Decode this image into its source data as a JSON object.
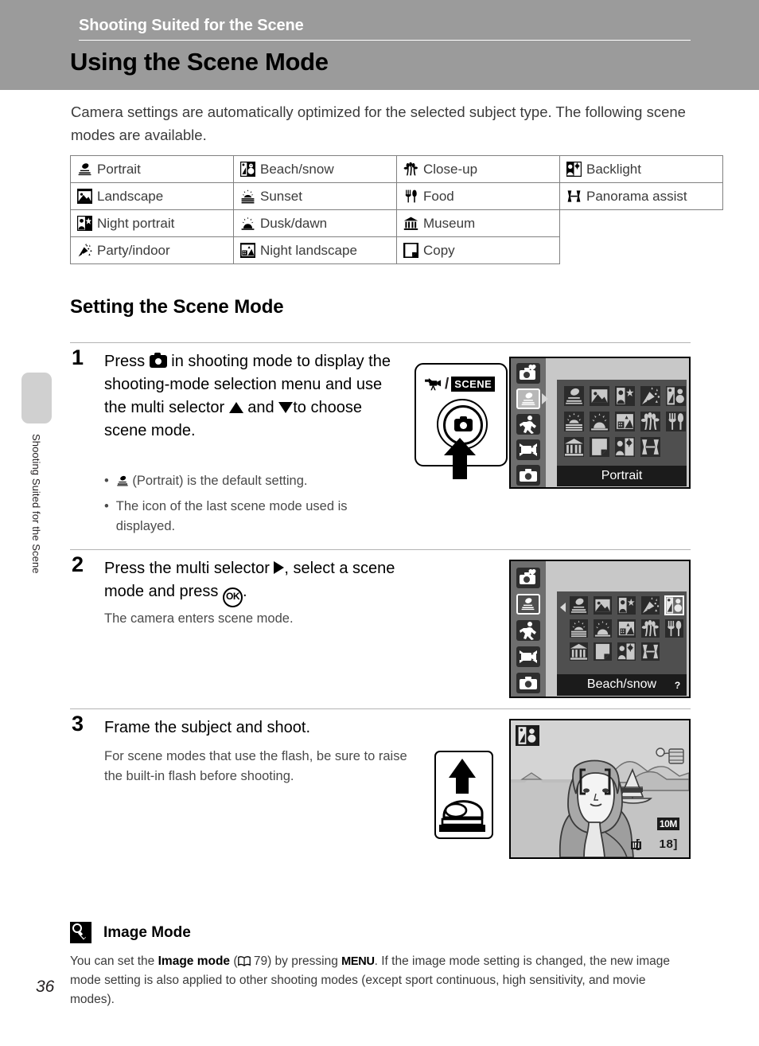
{
  "header": {
    "section_title": "Shooting Suited for the Scene",
    "chapter_title": "Using the Scene Mode"
  },
  "side": {
    "vertical_text": "Shooting Suited for the Scene",
    "page_number": "36"
  },
  "intro": "Camera settings are automatically optimized for the selected subject type. The following scene modes are available.",
  "scene_table": {
    "rows": [
      [
        {
          "icon": "portrait-icon",
          "label": "Portrait"
        },
        {
          "icon": "beach-snow-icon",
          "label": "Beach/snow"
        },
        {
          "icon": "close-up-icon",
          "label": "Close-up"
        },
        {
          "icon": "backlight-icon",
          "label": "Backlight"
        }
      ],
      [
        {
          "icon": "landscape-icon",
          "label": "Landscape"
        },
        {
          "icon": "sunset-icon",
          "label": "Sunset"
        },
        {
          "icon": "food-icon",
          "label": "Food"
        },
        {
          "icon": "panorama-assist-icon",
          "label": "Panorama assist"
        }
      ],
      [
        {
          "icon": "night-portrait-icon",
          "label": "Night portrait"
        },
        {
          "icon": "dusk-dawn-icon",
          "label": "Dusk/dawn"
        },
        {
          "icon": "museum-icon",
          "label": "Museum"
        },
        {
          "icon": "",
          "label": ""
        }
      ],
      [
        {
          "icon": "party-indoor-icon",
          "label": "Party/indoor"
        },
        {
          "icon": "night-landscape-icon",
          "label": "Night landscape"
        },
        {
          "icon": "copy-icon",
          "label": "Copy"
        },
        {
          "icon": "",
          "label": ""
        }
      ]
    ]
  },
  "section_heading": "Setting the Scene Mode",
  "steps": {
    "one": {
      "number": "1",
      "text_a": "Press",
      "text_b": "in shooting mode to display the shooting-mode selection menu and use the multi selector",
      "text_c": "and",
      "text_d": "to choose scene mode.",
      "bullets": [
        {
          "prefix": "",
          "text": "(Portrait) is the default setting."
        },
        {
          "prefix": "",
          "text": "The icon of the last scene mode used is displayed."
        }
      ],
      "dial": {
        "movie_label": "movie-mode-icon",
        "separator": "/",
        "scene_label": "SCENE"
      },
      "lcd": {
        "caption": "Portrait",
        "selected_index": 0,
        "rail": [
          "high-sensitivity-icon",
          "scene-mode-icon",
          "sport-mode-icon",
          "movie-mode-icon",
          "auto-mode-icon"
        ],
        "rail_selected": 1,
        "tiles": [
          [
            "portrait-icon",
            "landscape-icon",
            "night-portrait-icon",
            "party-indoor-icon",
            "beach-snow-icon"
          ],
          [
            "sunset-icon",
            "dusk-dawn-icon",
            "night-landscape-icon",
            "close-up-icon",
            "food-icon"
          ],
          [
            "museum-icon",
            "copy-icon",
            "backlight-icon",
            "panorama-assist-icon"
          ]
        ]
      }
    },
    "two": {
      "number": "2",
      "text_a": "Press the multi selector",
      "text_b": ", select a scene mode and press",
      "text_c": ".",
      "sub": "The camera enters scene mode.",
      "lcd": {
        "caption": "Beach/snow",
        "help_badge": "?",
        "rail_selected": 1,
        "selected_tile": {
          "row": 0,
          "col": 4
        }
      }
    },
    "three": {
      "number": "3",
      "title": "Frame the subject and shoot.",
      "sub": "For scene modes that use the flash, be sure to raise the built-in flash before shooting.",
      "photo": {
        "mode_badge": "beach-snow-icon",
        "image_size": "10M",
        "memory": "IN",
        "shots_remaining": "18"
      }
    }
  },
  "note": {
    "icon": "note-icon",
    "title": "Image Mode",
    "body_1": "You can set the ",
    "body_bold": "Image mode",
    "body_2": " (",
    "body_page": "79) by pressing ",
    "body_menu": "MENU",
    "body_3": ". If the image mode setting is changed, the new image mode setting is also applied to other shooting modes (except sport continuous, high sensitivity, and movie modes)."
  },
  "colors": {
    "header_band": "#9b9b9b",
    "rule": "#b3b3b3",
    "lcd_bg": "#c8c8c8",
    "lcd_rail": "#6e6e6e",
    "lcd_panel": "#4f4f4f",
    "lcd_tile": "#2b2b2b",
    "caption_bar": "#1b1b1b"
  }
}
